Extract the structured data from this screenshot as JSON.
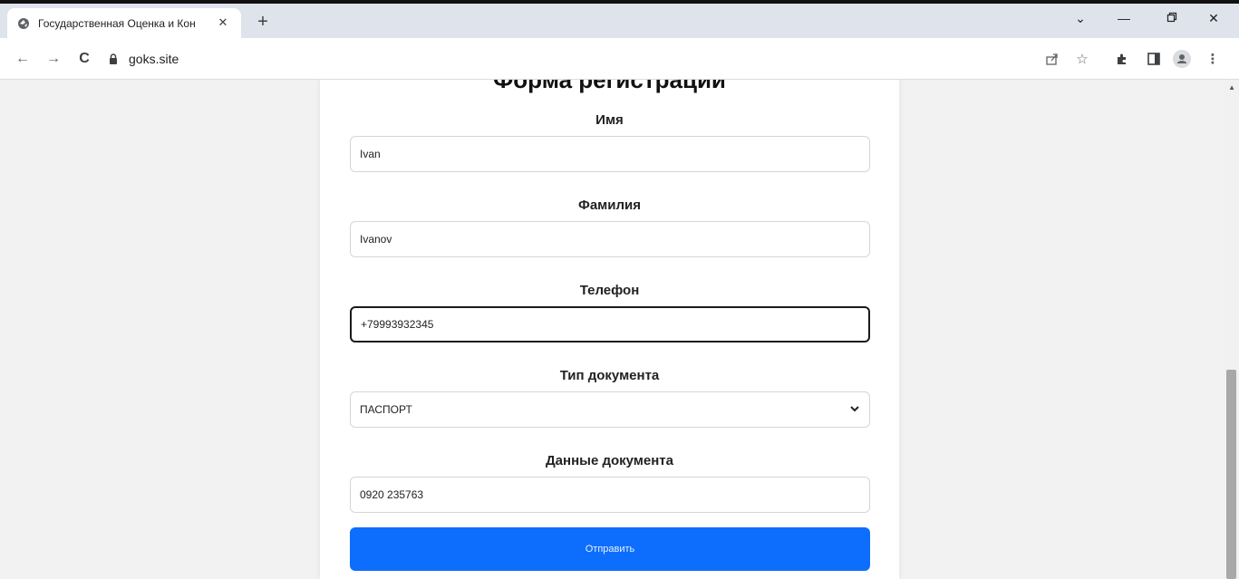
{
  "browser": {
    "tab_title": "Государственная Оценка и Кон",
    "url": "goks.site"
  },
  "form": {
    "title": "Форма регистрации",
    "first_name": {
      "label": "Имя",
      "value": "Ivan"
    },
    "last_name": {
      "label": "Фамилия",
      "value": "Ivanov"
    },
    "phone": {
      "label": "Телефон",
      "value": "+79993932345"
    },
    "doc_type": {
      "label": "Тип документа",
      "selected": "ПАСПОРТ"
    },
    "doc_data": {
      "label": "Данные документа",
      "value": "0920 235763"
    },
    "submit_label": "Отправить"
  },
  "colors": {
    "accent": "#0d6efd",
    "page_background": "#f2f2f2"
  }
}
